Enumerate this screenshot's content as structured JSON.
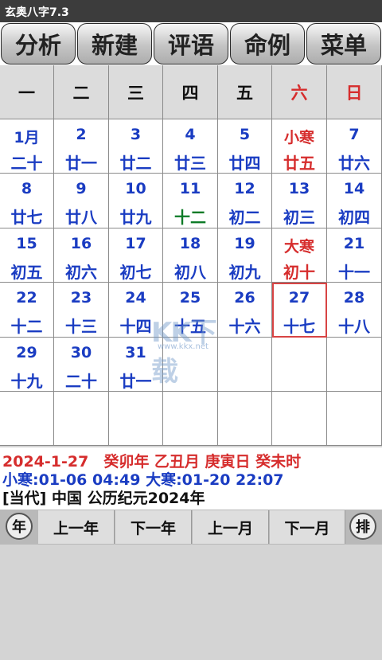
{
  "window": {
    "title": "玄奥八字7.3"
  },
  "toolbar": [
    {
      "label": "分析"
    },
    {
      "label": "新建"
    },
    {
      "label": "评语"
    },
    {
      "label": "命例"
    },
    {
      "label": "菜单"
    }
  ],
  "weekdays": [
    {
      "label": "一",
      "color": "#111111"
    },
    {
      "label": "二",
      "color": "#111111"
    },
    {
      "label": "三",
      "color": "#111111"
    },
    {
      "label": "四",
      "color": "#111111"
    },
    {
      "label": "五",
      "color": "#111111"
    },
    {
      "label": "六",
      "color": "#d62d2d"
    },
    {
      "label": "日",
      "color": "#d62d2d"
    }
  ],
  "days": [
    {
      "solar": "1月",
      "lunar": "二十"
    },
    {
      "solar": "2",
      "lunar": "廿一"
    },
    {
      "solar": "3",
      "lunar": "廿二"
    },
    {
      "solar": "4",
      "lunar": "廿三"
    },
    {
      "solar": "5",
      "lunar": "廿四"
    },
    {
      "solar": "小寒",
      "lunar": "廿五",
      "solar_red": true,
      "lunar_red": true
    },
    {
      "solar": "7",
      "lunar": "廿六"
    },
    {
      "solar": "8",
      "lunar": "廿七"
    },
    {
      "solar": "9",
      "lunar": "廿八"
    },
    {
      "solar": "10",
      "lunar": "廿九"
    },
    {
      "solar": "11",
      "lunar": "十二",
      "lunar_green": true
    },
    {
      "solar": "12",
      "lunar": "初二"
    },
    {
      "solar": "13",
      "lunar": "初三"
    },
    {
      "solar": "14",
      "lunar": "初四"
    },
    {
      "solar": "15",
      "lunar": "初五"
    },
    {
      "solar": "16",
      "lunar": "初六"
    },
    {
      "solar": "17",
      "lunar": "初七"
    },
    {
      "solar": "18",
      "lunar": "初八"
    },
    {
      "solar": "19",
      "lunar": "初九"
    },
    {
      "solar": "大寒",
      "lunar": "初十",
      "solar_red": true,
      "lunar_red": true
    },
    {
      "solar": "21",
      "lunar": "十一"
    },
    {
      "solar": "22",
      "lunar": "十二"
    },
    {
      "solar": "23",
      "lunar": "十三"
    },
    {
      "solar": "24",
      "lunar": "十四"
    },
    {
      "solar": "25",
      "lunar": "十五"
    },
    {
      "solar": "26",
      "lunar": "十六"
    },
    {
      "solar": "27",
      "lunar": "十七",
      "selected": true
    },
    {
      "solar": "28",
      "lunar": "十八"
    },
    {
      "solar": "29",
      "lunar": "十九"
    },
    {
      "solar": "30",
      "lunar": "二十"
    },
    {
      "solar": "31",
      "lunar": "廿一"
    }
  ],
  "watermark": {
    "big": "KK下载",
    "small": "www.kkx.net"
  },
  "info": {
    "line1": "2024-1-27　癸卯年 乙丑月 庚寅日 癸未时",
    "line2": "小寒:01-06 04:49 大寒:01-20 22:07",
    "line3": "[当代] 中国 公历纪元2024年"
  },
  "nav": {
    "year_circle": "年",
    "prev_year": "上一年",
    "next_year": "下一年",
    "prev_month": "上一月",
    "next_month": "下一月",
    "arrange_circle": "排"
  },
  "colors": {
    "solar_blue": "#1a3cc2",
    "festival_red": "#d62d2d",
    "lunar_green": "#0c7a26",
    "selected_border": "#d84444"
  }
}
